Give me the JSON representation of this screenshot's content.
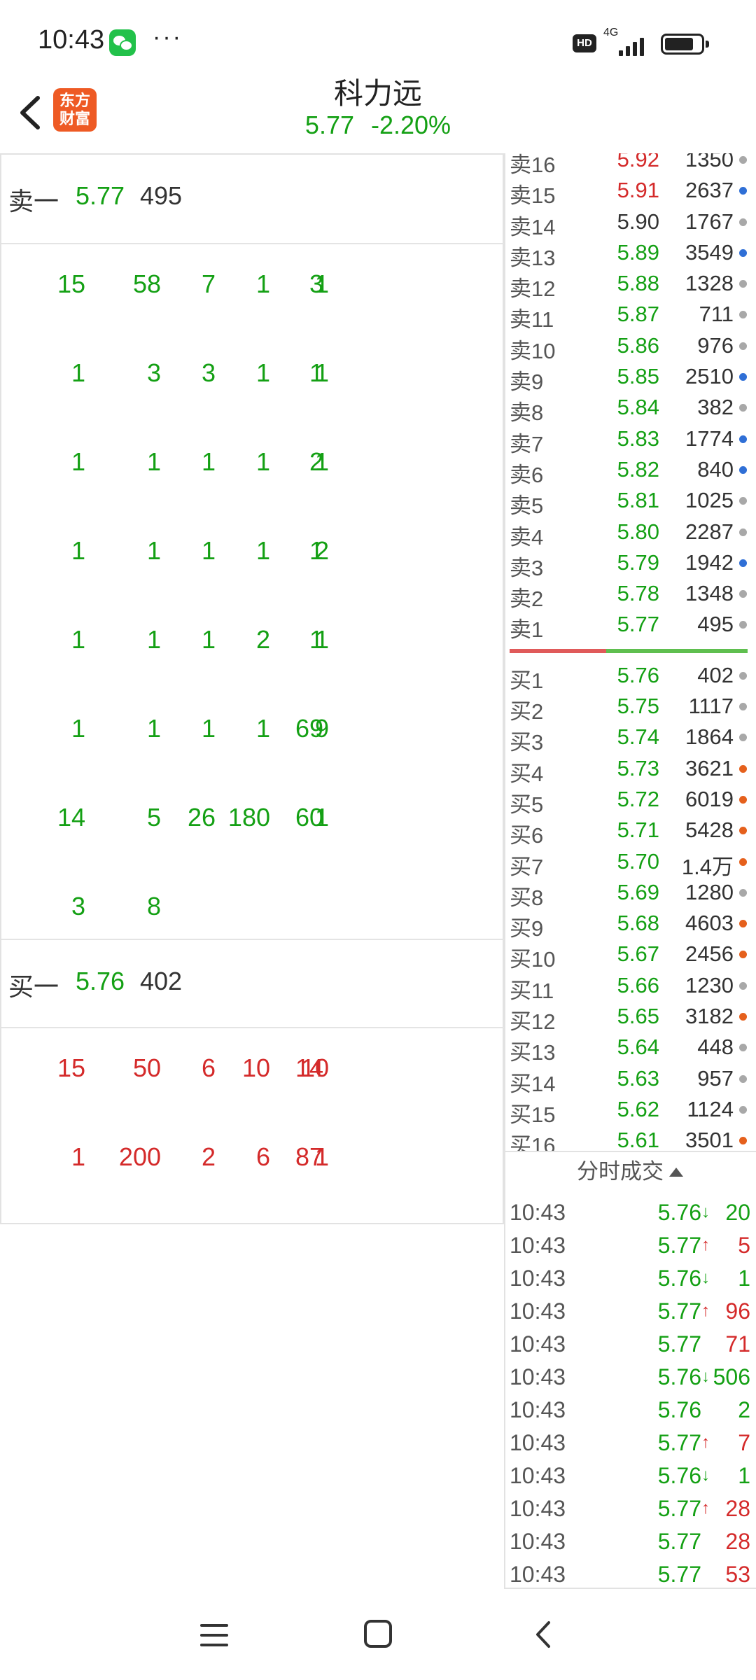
{
  "status": {
    "time": "10:43",
    "network": "4G",
    "hd": "HD",
    "more": "···"
  },
  "header": {
    "logo": "东方财富",
    "stock_name": "科力远",
    "price": "5.77",
    "change_pct": "-2.20%"
  },
  "sell_level": {
    "label": "卖一",
    "price": "5.77",
    "volume": "495"
  },
  "sell_queue": [
    [
      "15",
      "58",
      "7",
      "1",
      "3",
      "1"
    ],
    [
      "1",
      "3",
      "3",
      "1",
      "1",
      "1"
    ],
    [
      "1",
      "1",
      "1",
      "1",
      "2",
      "1"
    ],
    [
      "1",
      "1",
      "1",
      "1",
      "1",
      "2"
    ],
    [
      "1",
      "1",
      "1",
      "2",
      "1",
      "1"
    ],
    [
      "1",
      "1",
      "1",
      "1",
      "69",
      "9"
    ],
    [
      "14",
      "5",
      "26",
      "180",
      "60",
      "1"
    ],
    [
      "3",
      "8",
      "",
      "",
      "",
      ""
    ]
  ],
  "buy_level": {
    "label": "买一",
    "price": "5.76",
    "volume": "402"
  },
  "buy_queue": [
    [
      "15",
      "50",
      "6",
      "10",
      "14",
      "10"
    ],
    [
      "1",
      "200",
      "2",
      "6",
      "87",
      "1"
    ]
  ],
  "order_book": {
    "asks": [
      {
        "label": "卖16",
        "price": "5.92",
        "volume": "1350",
        "price_color": "red",
        "dot": "gray"
      },
      {
        "label": "卖15",
        "price": "5.91",
        "volume": "2637",
        "price_color": "red",
        "dot": "blue"
      },
      {
        "label": "卖14",
        "price": "5.90",
        "volume": "1767",
        "price_color": "black",
        "dot": "gray"
      },
      {
        "label": "卖13",
        "price": "5.89",
        "volume": "3549",
        "price_color": "green",
        "dot": "blue"
      },
      {
        "label": "卖12",
        "price": "5.88",
        "volume": "1328",
        "price_color": "green",
        "dot": "gray"
      },
      {
        "label": "卖11",
        "price": "5.87",
        "volume": "711",
        "price_color": "green",
        "dot": "gray"
      },
      {
        "label": "卖10",
        "price": "5.86",
        "volume": "976",
        "price_color": "green",
        "dot": "gray"
      },
      {
        "label": "卖9",
        "price": "5.85",
        "volume": "2510",
        "price_color": "green",
        "dot": "blue"
      },
      {
        "label": "卖8",
        "price": "5.84",
        "volume": "382",
        "price_color": "green",
        "dot": "gray"
      },
      {
        "label": "卖7",
        "price": "5.83",
        "volume": "1774",
        "price_color": "green",
        "dot": "blue"
      },
      {
        "label": "卖6",
        "price": "5.82",
        "volume": "840",
        "price_color": "green",
        "dot": "blue"
      },
      {
        "label": "卖5",
        "price": "5.81",
        "volume": "1025",
        "price_color": "green",
        "dot": "gray"
      },
      {
        "label": "卖4",
        "price": "5.80",
        "volume": "2287",
        "price_color": "green",
        "dot": "gray"
      },
      {
        "label": "卖3",
        "price": "5.79",
        "volume": "1942",
        "price_color": "green",
        "dot": "blue"
      },
      {
        "label": "卖2",
        "price": "5.78",
        "volume": "1348",
        "price_color": "green",
        "dot": "gray"
      },
      {
        "label": "卖1",
        "price": "5.77",
        "volume": "495",
        "price_color": "green",
        "dot": "gray"
      }
    ],
    "bids": [
      {
        "label": "买1",
        "price": "5.76",
        "volume": "402",
        "price_color": "green",
        "dot": "gray"
      },
      {
        "label": "买2",
        "price": "5.75",
        "volume": "1117",
        "price_color": "green",
        "dot": "gray"
      },
      {
        "label": "买3",
        "price": "5.74",
        "volume": "1864",
        "price_color": "green",
        "dot": "gray"
      },
      {
        "label": "买4",
        "price": "5.73",
        "volume": "3621",
        "price_color": "green",
        "dot": "orange"
      },
      {
        "label": "买5",
        "price": "5.72",
        "volume": "6019",
        "price_color": "green",
        "dot": "orange"
      },
      {
        "label": "买6",
        "price": "5.71",
        "volume": "5428",
        "price_color": "green",
        "dot": "orange"
      },
      {
        "label": "买7",
        "price": "5.70",
        "volume": "1.4万",
        "price_color": "green",
        "dot": "orange"
      },
      {
        "label": "买8",
        "price": "5.69",
        "volume": "1280",
        "price_color": "green",
        "dot": "gray"
      },
      {
        "label": "买9",
        "price": "5.68",
        "volume": "4603",
        "price_color": "green",
        "dot": "orange"
      },
      {
        "label": "买10",
        "price": "5.67",
        "volume": "2456",
        "price_color": "green",
        "dot": "orange"
      },
      {
        "label": "买11",
        "price": "5.66",
        "volume": "1230",
        "price_color": "green",
        "dot": "gray"
      },
      {
        "label": "买12",
        "price": "5.65",
        "volume": "3182",
        "price_color": "green",
        "dot": "orange"
      },
      {
        "label": "买13",
        "price": "5.64",
        "volume": "448",
        "price_color": "green",
        "dot": "gray"
      },
      {
        "label": "买14",
        "price": "5.63",
        "volume": "957",
        "price_color": "green",
        "dot": "gray"
      },
      {
        "label": "买15",
        "price": "5.62",
        "volume": "1124",
        "price_color": "green",
        "dot": "gray"
      },
      {
        "label": "买16",
        "price": "5.61",
        "volume": "3501",
        "price_color": "green",
        "dot": "orange"
      }
    ]
  },
  "trades": {
    "title": "分时成交",
    "rows": [
      {
        "time": "10:43",
        "price": "5.76",
        "dir": "down",
        "volume": "20"
      },
      {
        "time": "10:43",
        "price": "5.77",
        "dir": "up",
        "volume": "5"
      },
      {
        "time": "10:43",
        "price": "5.76",
        "dir": "down",
        "volume": "1"
      },
      {
        "time": "10:43",
        "price": "5.77",
        "dir": "up",
        "volume": "96"
      },
      {
        "time": "10:43",
        "price": "5.77",
        "dir": "none",
        "volume": "71"
      },
      {
        "time": "10:43",
        "price": "5.76",
        "dir": "down",
        "volume": "506"
      },
      {
        "time": "10:43",
        "price": "5.76",
        "dir": "none",
        "volume": "2"
      },
      {
        "time": "10:43",
        "price": "5.77",
        "dir": "up",
        "volume": "7"
      },
      {
        "time": "10:43",
        "price": "5.76",
        "dir": "down",
        "volume": "1"
      },
      {
        "time": "10:43",
        "price": "5.77",
        "dir": "up",
        "volume": "28"
      },
      {
        "time": "10:43",
        "price": "5.77",
        "dir": "none",
        "volume": "28"
      },
      {
        "time": "10:43",
        "price": "5.77",
        "dir": "none",
        "volume": "53"
      }
    ]
  },
  "colors": {
    "green": "#14a014",
    "red": "#d42a2a",
    "dot_gray": "#a8a8a8",
    "dot_blue": "#2f6fd6",
    "dot_orange": "#e5601c"
  }
}
